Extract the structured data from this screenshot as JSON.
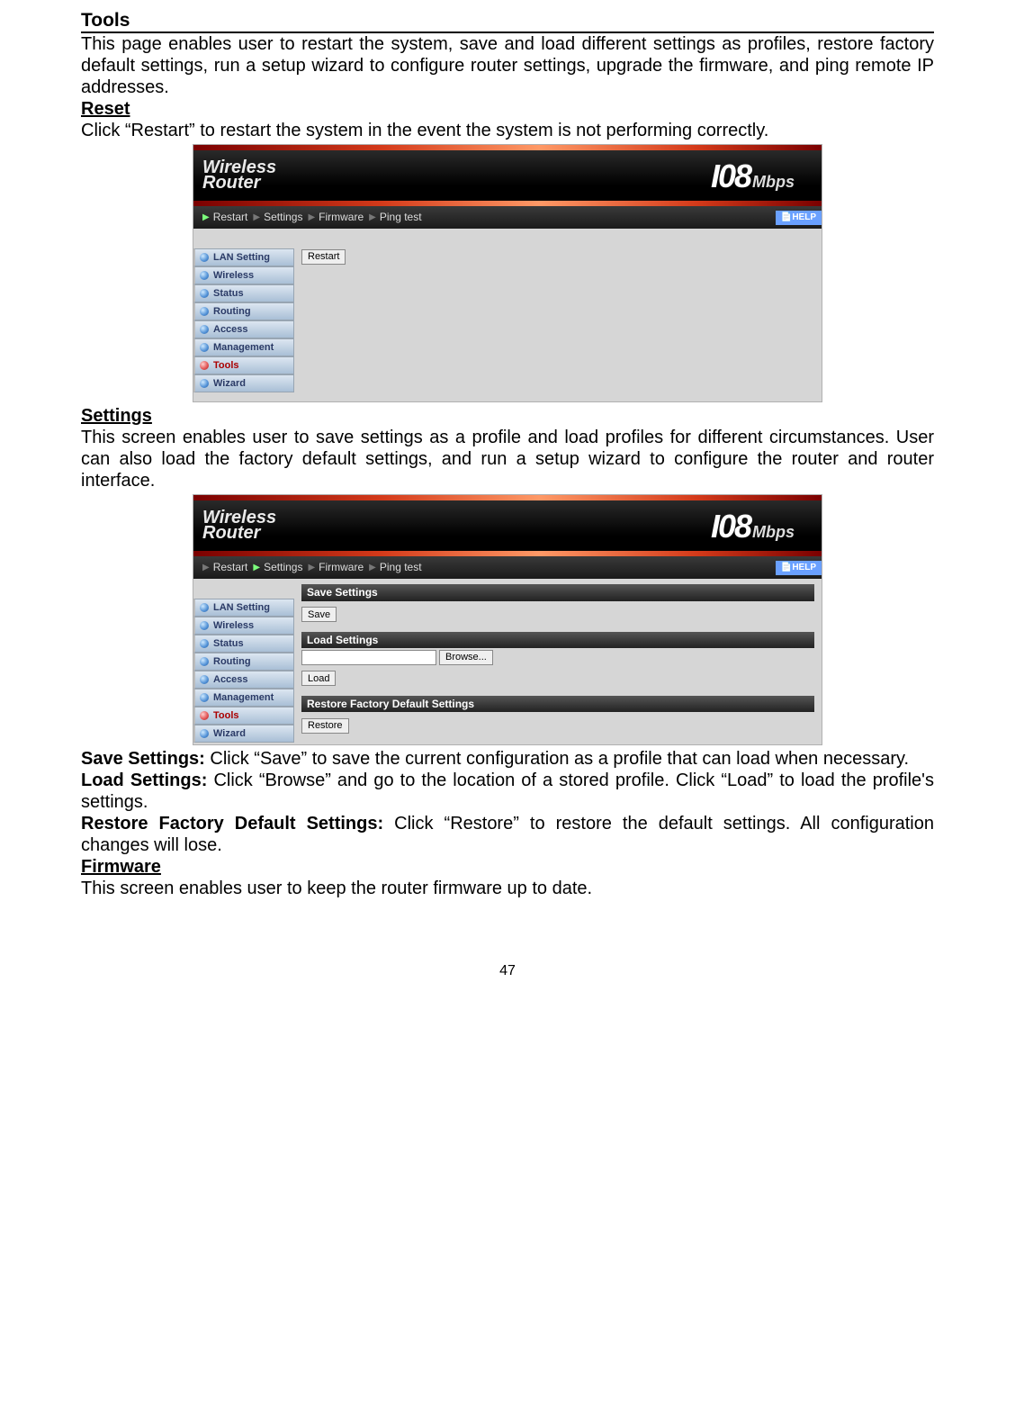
{
  "headings": {
    "tools": "Tools",
    "reset": "Reset",
    "settings": "Settings",
    "firmware": "Firmware"
  },
  "paragraphs": {
    "tools_intro": "This page enables user to restart the system, save and load different settings as profiles, restore factory default settings, run a setup wizard to configure router settings, upgrade the firmware, and ping remote IP addresses.",
    "reset_body": "Click “Restart” to restart the system in the event the system is not performing correctly.",
    "settings_body": "This screen enables user to save settings as a profile and load profiles for different circumstances. User can also load the factory default settings, and run a setup wizard to configure the router and router interface.",
    "save_label": "Save Settings: ",
    "save_body": "Click “Save” to save the current configuration as a profile that can load when necessary.",
    "load_label": "Load Settings: ",
    "load_body": "Click “Browse” and go to the location of a stored profile. Click “Load” to load the profile's settings.",
    "restore_label": "Restore Factory Default Settings: ",
    "restore_body": "Click “Restore” to restore the default settings. All configuration changes will lose.",
    "firmware_body": "This screen enables user to keep the router firmware up to date."
  },
  "router_header": {
    "brand_line1": "Wireless",
    "brand_line2": "Router",
    "speed_num": "I08",
    "speed_unit": "Mbps"
  },
  "tabs": {
    "restart": "Restart",
    "settings": "Settings",
    "firmware": "Firmware",
    "ping": "Ping test",
    "help": "HELP"
  },
  "nav": {
    "items": [
      {
        "label": "LAN Setting"
      },
      {
        "label": "Wireless"
      },
      {
        "label": "Status"
      },
      {
        "label": "Routing"
      },
      {
        "label": "Access"
      },
      {
        "label": "Management"
      },
      {
        "label": "Tools",
        "active": true
      },
      {
        "label": "Wizard"
      }
    ]
  },
  "buttons": {
    "restart": "Restart",
    "save": "Save",
    "browse": "Browse...",
    "load": "Load",
    "restore": "Restore"
  },
  "panel_titles": {
    "save": "Save Settings",
    "load": "Load Settings",
    "restore": "Restore Factory Default Settings"
  },
  "page_number": "47"
}
